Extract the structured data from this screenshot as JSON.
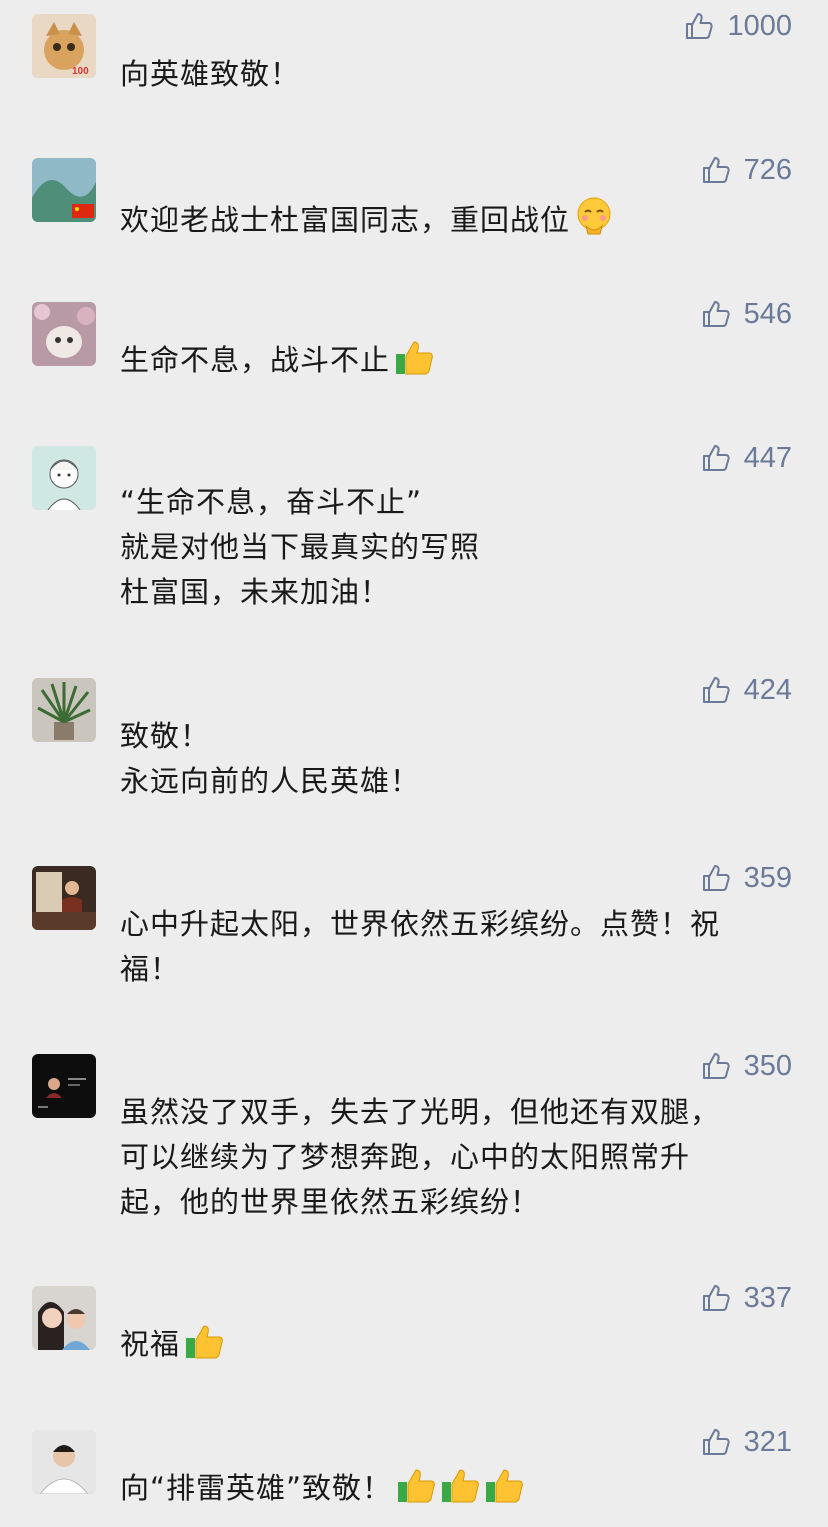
{
  "comments": [
    {
      "avatar": "cartoon-cat-avatar",
      "likes": "1000",
      "text": "向英雄致敬！",
      "emoji": []
    },
    {
      "avatar": "landscape-flag-avatar",
      "likes": "726",
      "text": "欢迎老战士杜富国同志，重回战位",
      "emoji": [
        "blush-hand-emoji"
      ]
    },
    {
      "avatar": "kitten-flowers-avatar",
      "likes": "546",
      "text": "生命不息，战斗不止",
      "emoji": [
        "thumbs-up-emoji"
      ]
    },
    {
      "avatar": "anime-boy-avatar",
      "likes": "447",
      "text": "“生命不息，奋斗不止”\n就是对他当下最真实的写照\n杜富国，未来加油！",
      "emoji": []
    },
    {
      "avatar": "potted-plant-avatar",
      "likes": "424",
      "text": "致敬！\n永远向前的人民英雄！",
      "emoji": []
    },
    {
      "avatar": "person-window-avatar",
      "likes": "359",
      "text": "心中升起太阳，世界依然五彩缤纷。点赞！祝\n福！",
      "emoji": []
    },
    {
      "avatar": "dark-poster-avatar",
      "likes": "350",
      "text": "虽然没了双手，失去了光明，但他还有双腿，\n可以继续为了梦想奔跑，心中的太阳照常升\n起，他的世界里依然五彩缤纷！",
      "emoji": []
    },
    {
      "avatar": "mother-child-avatar",
      "likes": "337",
      "text": "祝福",
      "emoji": [
        "thumbs-up-emoji"
      ]
    },
    {
      "avatar": "man-white-shirt-avatar",
      "likes": "321",
      "text": "向“排雷英雄”致敬！",
      "emoji": [
        "thumbs-up-emoji",
        "thumbs-up-emoji",
        "thumbs-up-emoji"
      ]
    }
  ],
  "colors": {
    "background": "#ededed",
    "like_color": "#6b7a99",
    "text_color": "#191919"
  }
}
